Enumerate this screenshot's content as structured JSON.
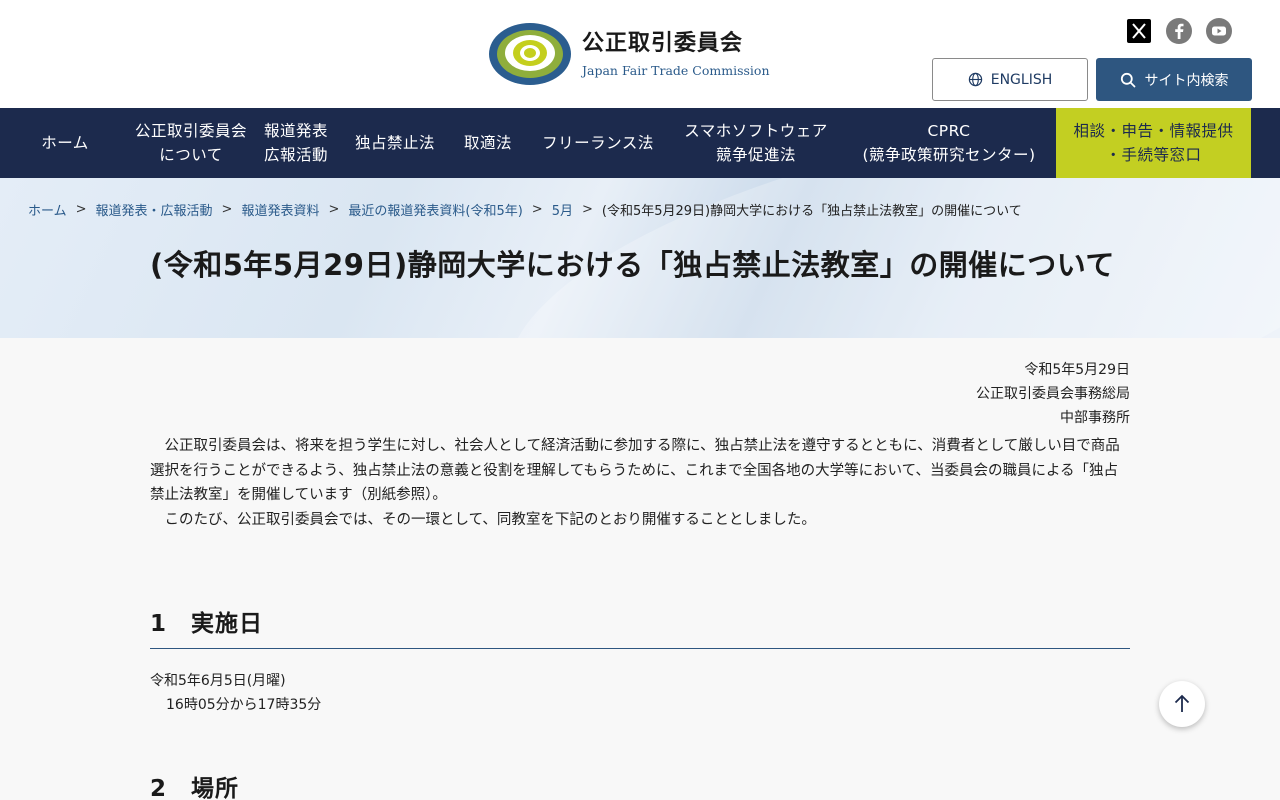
{
  "header": {
    "org_name_ja": "公正取引委員会",
    "org_name_en": "Japan Fair Trade Commission",
    "logo_ring_text": "JAPAN FAIR TRADE COMMISSION",
    "english_label": "ENGLISH",
    "search_label": "サイト内検索",
    "social": [
      "x-icon",
      "facebook-icon",
      "youtube-icon"
    ]
  },
  "nav": {
    "items": [
      {
        "label": "ホーム",
        "name": "nav-home"
      },
      {
        "label": "公正取引委員会\nについて",
        "name": "nav-about"
      },
      {
        "label": "報道発表\n広報活動",
        "name": "nav-press"
      },
      {
        "label": "独占禁止法",
        "name": "nav-antimonopoly"
      },
      {
        "label": "取適法",
        "name": "nav-subcontract"
      },
      {
        "label": "フリーランス法",
        "name": "nav-freelance"
      },
      {
        "label": "スマホソフトウェア\n競争促進法",
        "name": "nav-smartphone"
      },
      {
        "label": "CPRC\n(競争政策研究センター)",
        "name": "nav-cprc"
      },
      {
        "label": "相談・申告・情報提供\n・手続等窓口",
        "name": "nav-consultation"
      }
    ]
  },
  "breadcrumb": {
    "items": [
      "ホーム",
      "報道発表・広報活動",
      "報道発表資料",
      "最近の報道発表資料(令和5年)",
      "5月"
    ],
    "current": "(令和5年5月29日)静岡大学における「独占禁止法教室」の開催について"
  },
  "page": {
    "title": "(令和5年5月29日)静岡大学における「独占禁止法教室」の開催について",
    "date": "令和5年5月29日",
    "issuer1": "公正取引委員会事務総局",
    "issuer2": "中部事務所",
    "para1": "公正取引委員会は、将来を担う学生に対し、社会人として経済活動に参加する際に、独占禁止法を遵守するとともに、消費者として厳しい目で商品選択を行うことができるよう、独占禁止法の意義と役割を理解してもらうために、これまで全国各地の大学等において、当委員会の職員による「独占禁止法教室」を開催しています（別紙参照）。",
    "para2": "このたび、公正取引委員会では、その一環として、同教室を下記のとおり開催することとしました。",
    "section1_title": "1　実施日",
    "section1_date": "令和5年6月5日(月曜)",
    "section1_time": "16時05分から17時35分",
    "section2_title": "2　場所"
  }
}
